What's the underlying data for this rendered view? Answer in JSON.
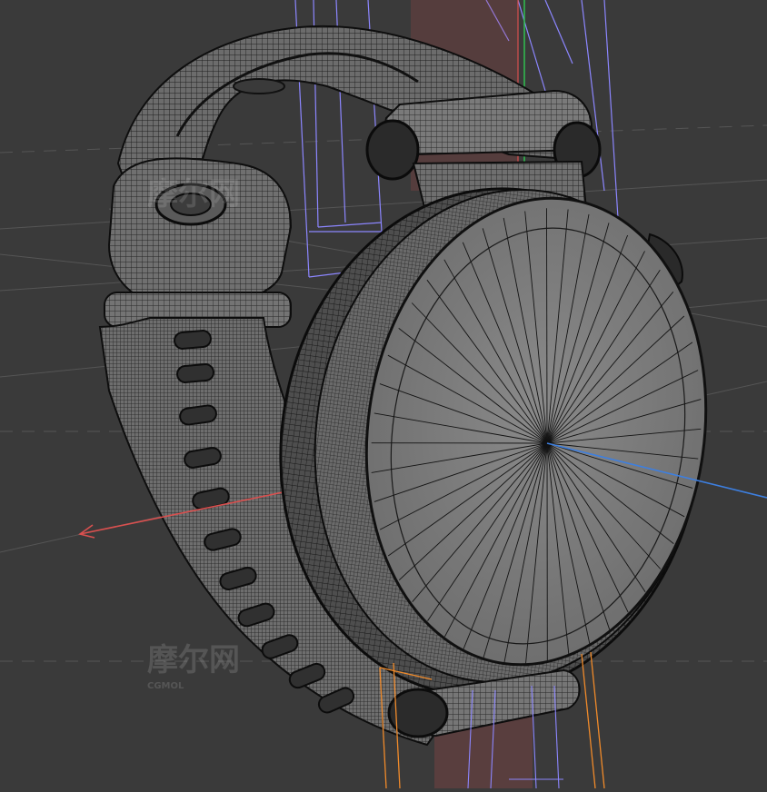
{
  "viewport": {
    "background": "#3a3a3a",
    "grid_color": "#555555",
    "mesh_color": "#111111",
    "surface_color": "#7b7b7b",
    "axis_x_color": "#d9504f",
    "axis_y_color": "#2fbf4f",
    "axis_z_color": "#3d7fe0",
    "helper_violet": "#8c86ff",
    "helper_orange": "#f08a2a"
  },
  "watermark": {
    "text_cn": "摩尔网",
    "text_en": "CGMOL"
  },
  "model": {
    "object": "smartwatch-wireframe"
  }
}
